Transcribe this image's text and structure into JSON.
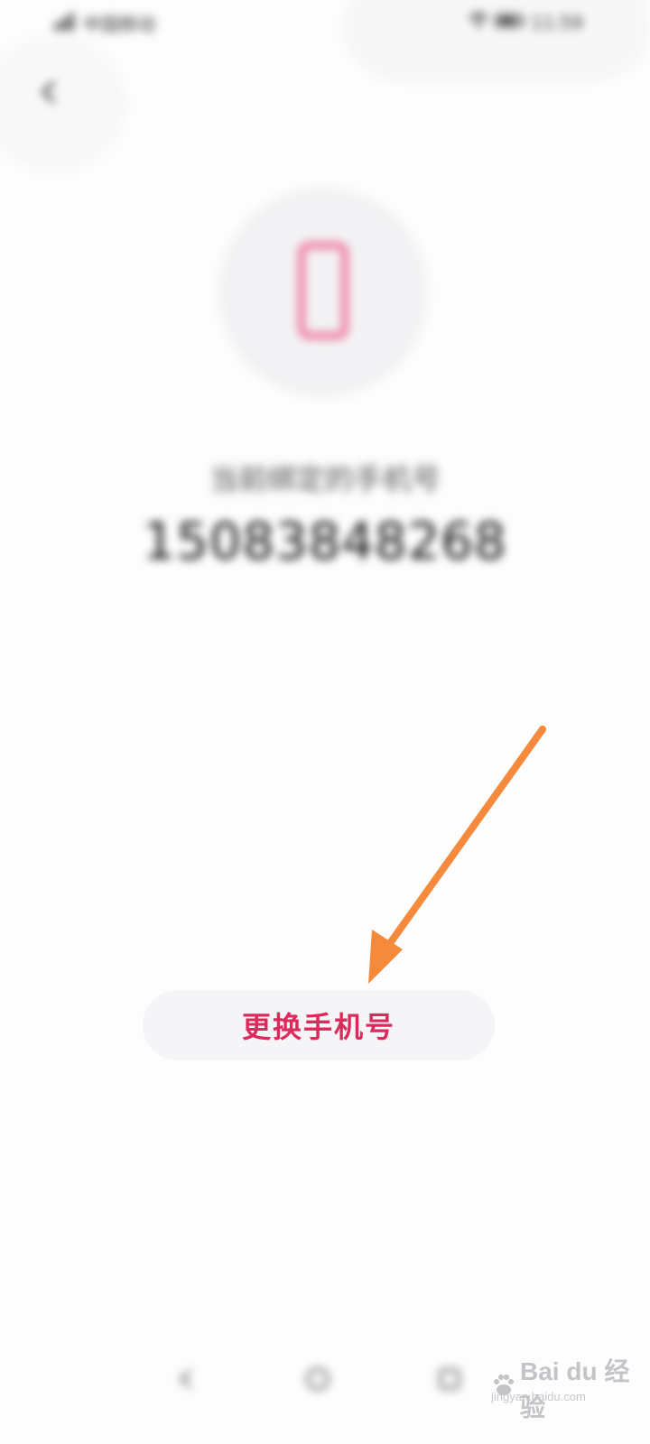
{
  "status_bar": {
    "left_text": "中国移动",
    "right_text": "11:59"
  },
  "header": {
    "back_icon": "arrow-left-icon"
  },
  "content": {
    "hint": "当前绑定的手机号",
    "phone_number": "15083848268",
    "phone_icon": "smartphone-icon",
    "phone_icon_color": "#f07ba0"
  },
  "actions": {
    "change_phone_label": "更换手机号",
    "label_color": "#dc2a5c"
  },
  "annotation": {
    "arrow_color": "#f58a3c"
  },
  "nav": {
    "back_icon": "nav-back-icon",
    "home_icon": "nav-home-icon",
    "recents_icon": "nav-recents-icon"
  },
  "watermark": {
    "brand": "Bai du 经验",
    "url": "jingyan.baidu.com"
  }
}
